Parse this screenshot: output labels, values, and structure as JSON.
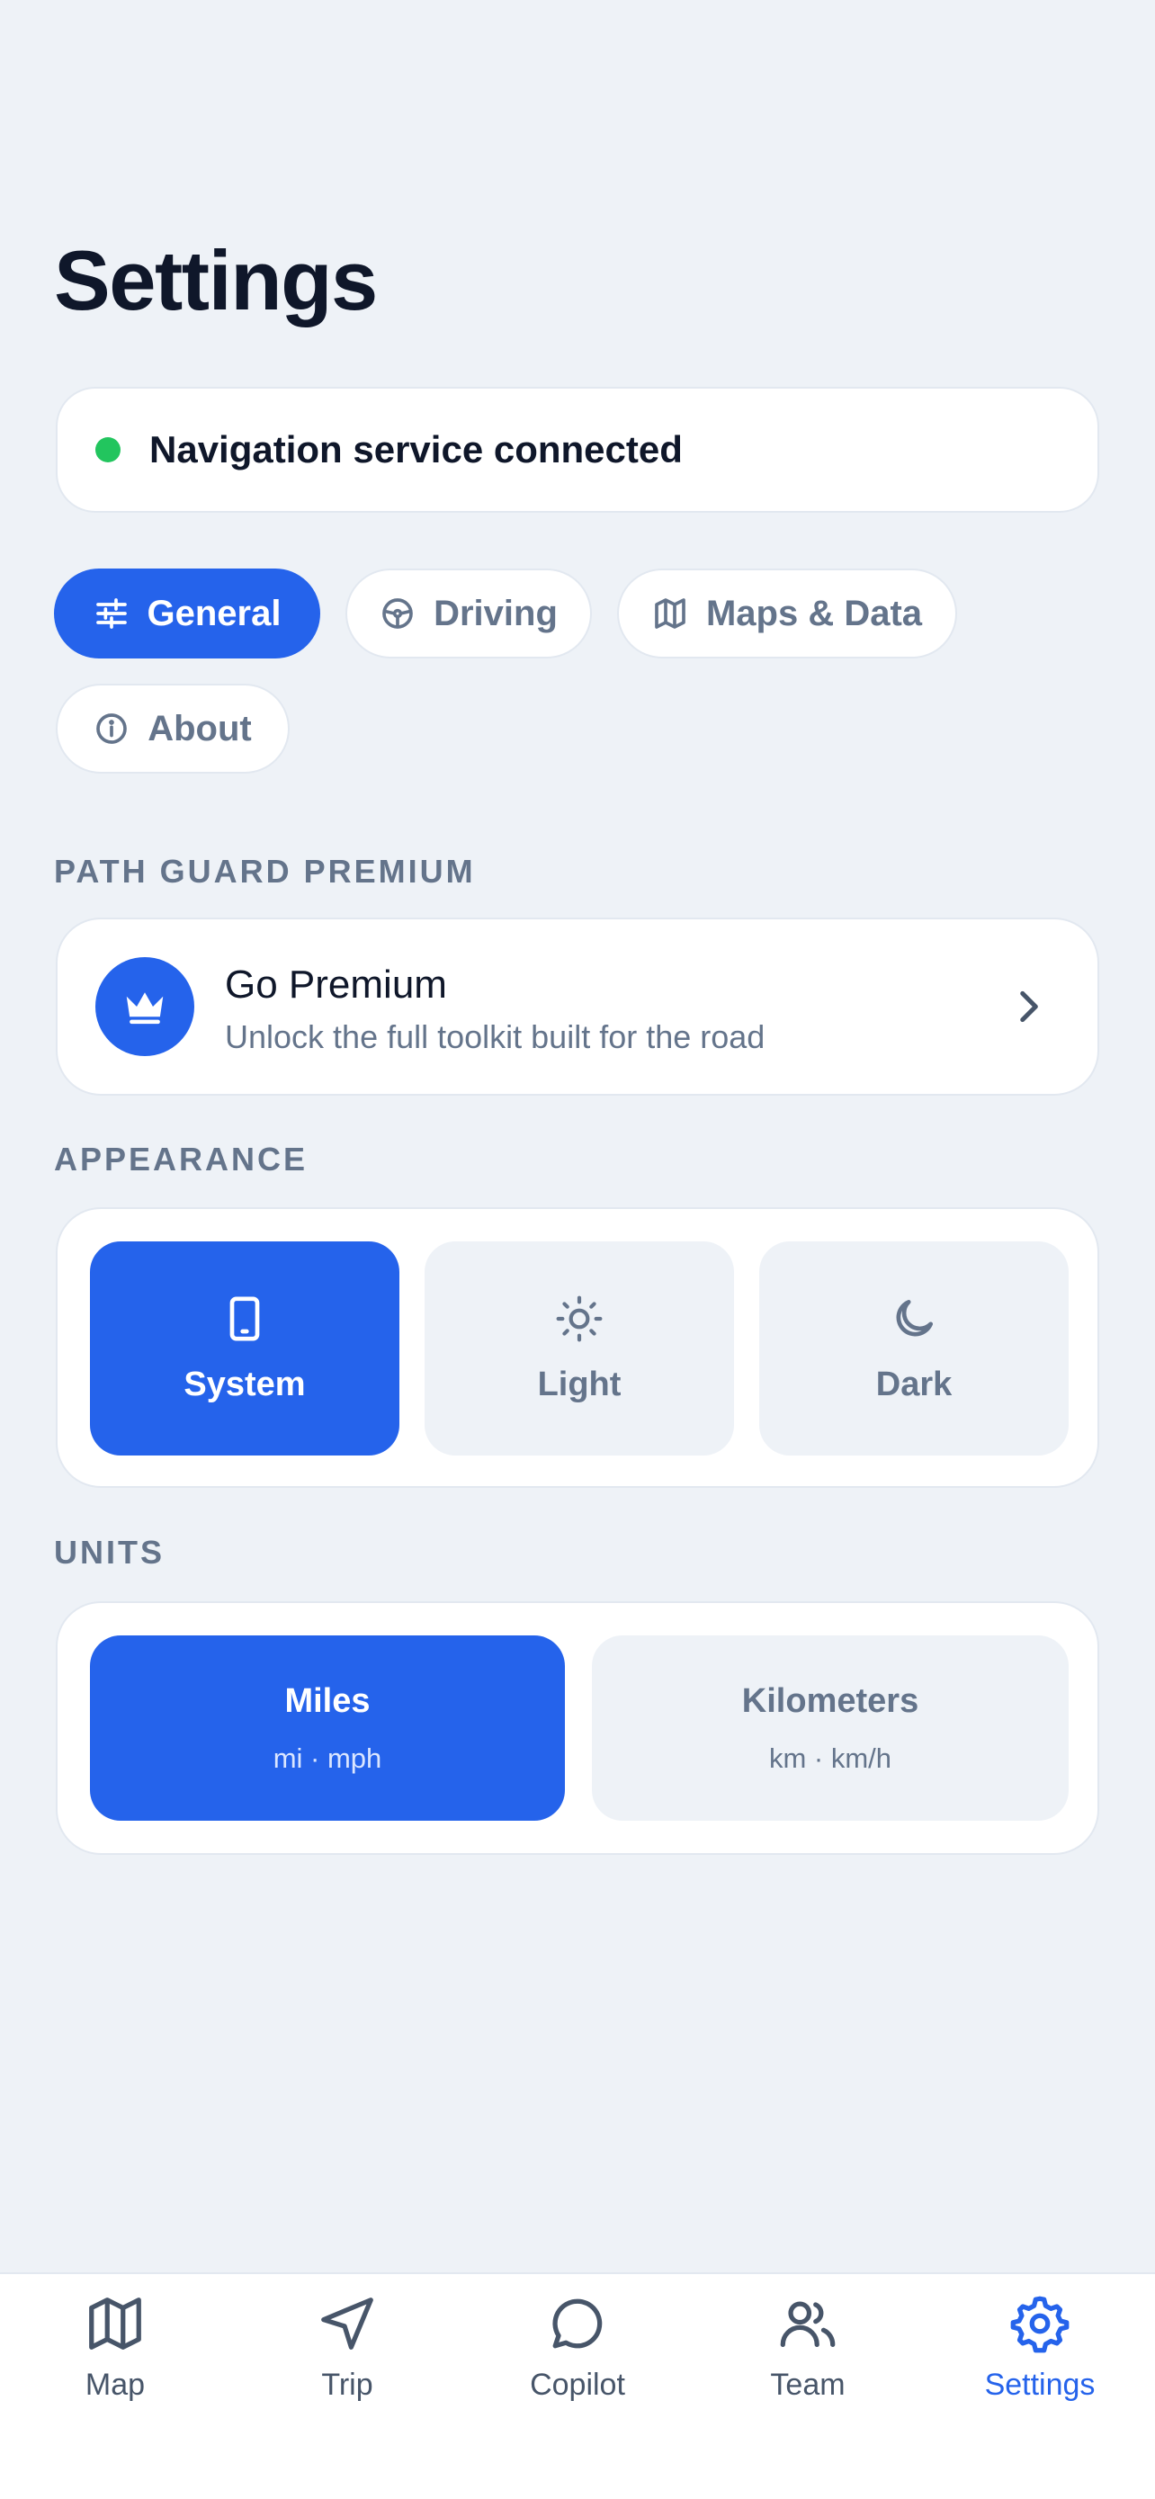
{
  "page": {
    "title": "Settings"
  },
  "status": {
    "text": "Navigation service connected",
    "color": "#22c55e"
  },
  "tabs": [
    {
      "label": "General",
      "icon": "sliders-icon",
      "active": true
    },
    {
      "label": "Driving",
      "icon": "steering-wheel-icon",
      "active": false
    },
    {
      "label": "Maps & Data",
      "icon": "map-icon",
      "active": false
    },
    {
      "label": "About",
      "icon": "info-icon",
      "active": false
    }
  ],
  "premium": {
    "section_label": "PATH GUARD PREMIUM",
    "title": "Go Premium",
    "subtitle": "Unlock the full toolkit built for the road",
    "icon": "crown-icon"
  },
  "appearance": {
    "section_label": "APPEARANCE",
    "options": [
      {
        "label": "System",
        "icon": "phone-icon",
        "selected": true
      },
      {
        "label": "Light",
        "icon": "sun-icon",
        "selected": false
      },
      {
        "label": "Dark",
        "icon": "moon-icon",
        "selected": false
      }
    ]
  },
  "units": {
    "section_label": "UNITS",
    "options": [
      {
        "label": "Miles",
        "sub": "mi · mph",
        "selected": true
      },
      {
        "label": "Kilometers",
        "sub": "km · km/h",
        "selected": false
      }
    ]
  },
  "nav": {
    "items": [
      {
        "label": "Map",
        "icon": "map-icon",
        "active": false
      },
      {
        "label": "Trip",
        "icon": "navigation-arrow-icon",
        "active": false
      },
      {
        "label": "Copilot",
        "icon": "chat-bubble-icon",
        "active": false
      },
      {
        "label": "Team",
        "icon": "users-icon",
        "active": false
      },
      {
        "label": "Settings",
        "icon": "gear-icon",
        "active": true
      }
    ]
  },
  "colors": {
    "accent": "#2563eb",
    "background": "#eef2f7",
    "text": "#0f172a",
    "muted": "#64748b"
  }
}
